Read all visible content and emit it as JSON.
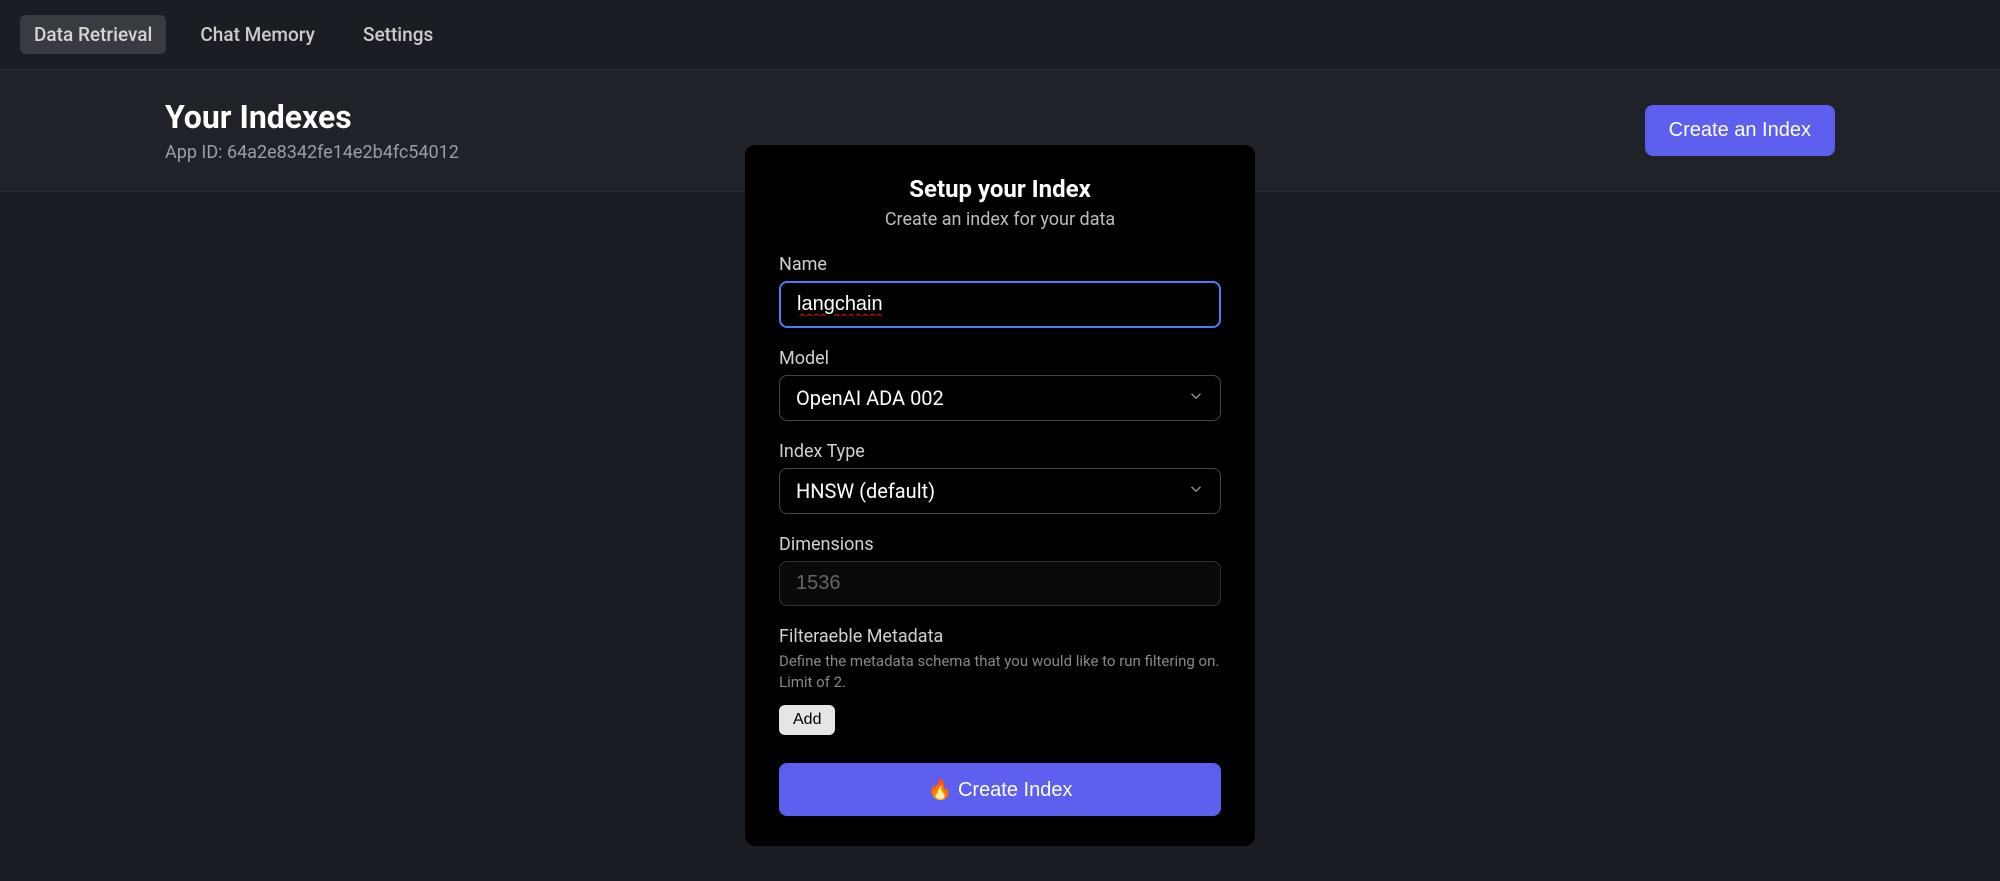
{
  "nav": {
    "tabs": [
      {
        "label": "Data Retrieval",
        "active": true
      },
      {
        "label": "Chat Memory",
        "active": false
      },
      {
        "label": "Settings",
        "active": false
      }
    ]
  },
  "header": {
    "title": "Your Indexes",
    "app_id_label": "App ID: 64a2e8342fe14e2b4fc54012",
    "create_button": "Create an Index"
  },
  "modal": {
    "title": "Setup your Index",
    "subtitle": "Create an index for your data",
    "name": {
      "label": "Name",
      "value": "langchain"
    },
    "model": {
      "label": "Model",
      "selected": "OpenAI ADA 002"
    },
    "index_type": {
      "label": "Index Type",
      "selected": "HNSW (default)"
    },
    "dimensions": {
      "label": "Dimensions",
      "placeholder": "1536",
      "value": ""
    },
    "filterable_metadata": {
      "title": "Filteraeble Metadata",
      "description": "Define the metadata schema that you would like to run filtering on. Limit of 2.",
      "add_button": "Add"
    },
    "submit_button": "🔥 Create Index"
  }
}
